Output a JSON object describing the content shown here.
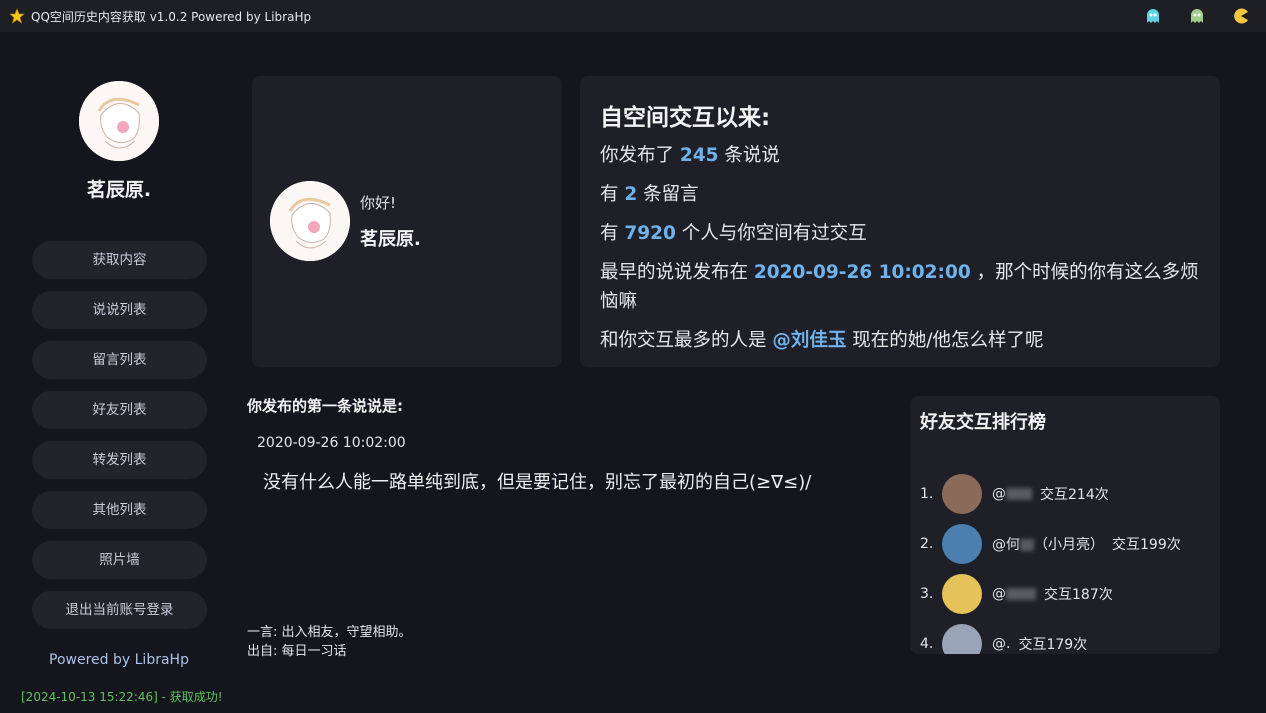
{
  "window": {
    "title": "QQ空间历史内容获取 v1.0.2 Powered by LibraHp",
    "icons": [
      "star-icon",
      "ghost-cyan-icon",
      "ghost-green-icon",
      "pacman-icon"
    ]
  },
  "sidebar": {
    "username": "茗辰原.",
    "nav": [
      {
        "label": "获取内容"
      },
      {
        "label": "说说列表"
      },
      {
        "label": "留言列表"
      },
      {
        "label": "好友列表"
      },
      {
        "label": "转发列表"
      },
      {
        "label": "其他列表"
      },
      {
        "label": "照片墙"
      },
      {
        "label": "退出当前账号登录"
      }
    ],
    "powered": "Powered by LibraHp",
    "status": "[2024-10-13 15:22:46] - 获取成功!"
  },
  "welcome": {
    "greeting": "你好!",
    "name": "茗辰原."
  },
  "stats": {
    "heading": "自空间交互以来:",
    "posts_prefix": "你发布了 ",
    "posts_count": "245",
    "posts_suffix": " 条说说",
    "msgs_prefix": "有 ",
    "msgs_count": "2",
    "msgs_suffix": " 条留言",
    "people_prefix": "有 ",
    "people_count": "7920",
    "people_suffix": " 个人与你空间有过交互",
    "earliest_prefix": "最早的说说发布在 ",
    "earliest_date": "2020-09-26 10:02:00",
    "earliest_suffix": " ，那个时候的你有这么多烦恼嘛",
    "top_prefix": "和你交互最多的人是 ",
    "top_name": "@刘佳玉",
    "top_suffix": " 现在的她/他怎么样了呢"
  },
  "first_post": {
    "label": "你发布的第一条说说是:",
    "date": "2020-09-26 10:02:00",
    "text": "没有什么人能一路单纯到底，但是要记住，别忘了最初的自己(≥∇≤)/"
  },
  "quote": {
    "line1": "一言: 出入相友，守望相助。",
    "line2": "出自: 每日一习话"
  },
  "ranking": {
    "title": "好友交互排行榜",
    "rows": [
      {
        "num": "1.",
        "name_start": "@",
        "name_end": "",
        "count": "交互214次",
        "avatar_color": "#8a6b5a"
      },
      {
        "num": "2.",
        "name_start": "@何",
        "name_end": "（小月亮）",
        "count": "交互199次",
        "avatar_color": "#4a7fb0"
      },
      {
        "num": "3.",
        "name_start": "@",
        "name_end": "",
        "count": "交互187次",
        "avatar_color": "#e6c35a"
      },
      {
        "num": "4.",
        "name_start": "@.",
        "name_end": "",
        "count": "交互179次",
        "avatar_color": "#9aa4b8"
      }
    ]
  }
}
